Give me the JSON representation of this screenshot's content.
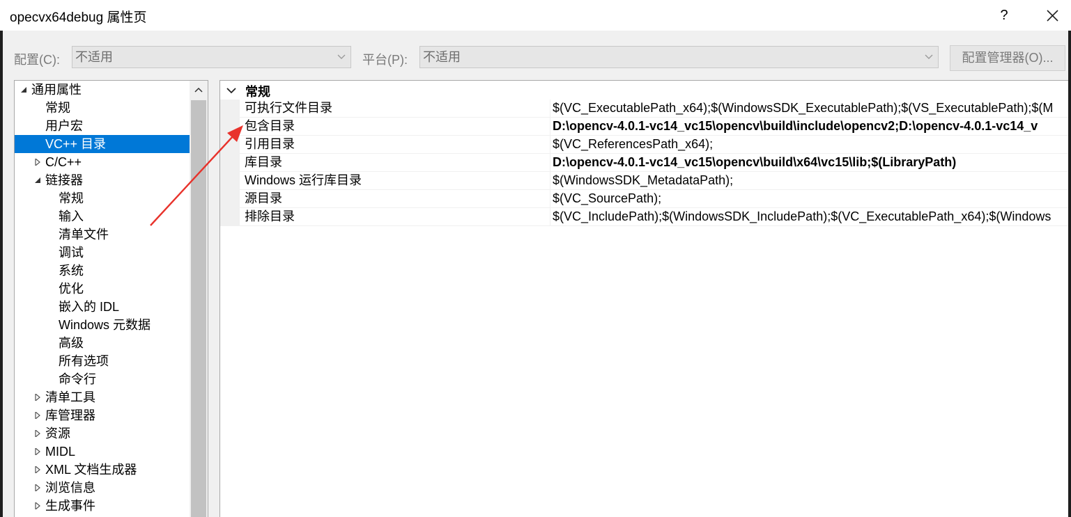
{
  "window": {
    "title": "opecvx64debug 属性页",
    "help_label": "?"
  },
  "toolbar": {
    "config_label": "配置(C):",
    "config_value": "不适用",
    "platform_label": "平台(P):",
    "platform_value": "不适用",
    "config_manager_label": "配置管理器(O)..."
  },
  "tree": {
    "items": [
      {
        "label": "通用属性",
        "expander": "expanded"
      },
      {
        "label": "常规"
      },
      {
        "label": "用户宏"
      },
      {
        "label": "VC++ 目录",
        "selected": true
      },
      {
        "label": "C/C++",
        "expander": "collapsed"
      },
      {
        "label": "链接器",
        "expander": "expanded"
      },
      {
        "label": "常规"
      },
      {
        "label": "输入"
      },
      {
        "label": "清单文件"
      },
      {
        "label": "调试"
      },
      {
        "label": "系统"
      },
      {
        "label": "优化"
      },
      {
        "label": "嵌入的 IDL"
      },
      {
        "label": "Windows 元数据"
      },
      {
        "label": "高级"
      },
      {
        "label": "所有选项"
      },
      {
        "label": "命令行"
      },
      {
        "label": "清单工具",
        "expander": "collapsed"
      },
      {
        "label": "库管理器",
        "expander": "collapsed"
      },
      {
        "label": "资源",
        "expander": "collapsed"
      },
      {
        "label": "MIDL",
        "expander": "collapsed"
      },
      {
        "label": "XML 文档生成器",
        "expander": "collapsed"
      },
      {
        "label": "浏览信息",
        "expander": "collapsed"
      },
      {
        "label": "生成事件",
        "expander": "collapsed"
      }
    ]
  },
  "grid": {
    "category": "常规",
    "rows": [
      {
        "name": "可执行文件目录",
        "value": "$(VC_ExecutablePath_x64);$(WindowsSDK_ExecutablePath);$(VS_ExecutablePath);$(M",
        "bold": false
      },
      {
        "name": "包含目录",
        "value": "D:\\opencv-4.0.1-vc14_vc15\\opencv\\build\\include\\opencv2;D:\\opencv-4.0.1-vc14_v",
        "bold": true
      },
      {
        "name": "引用目录",
        "value": "$(VC_ReferencesPath_x64);",
        "bold": false
      },
      {
        "name": "库目录",
        "value": "D:\\opencv-4.0.1-vc14_vc15\\opencv\\build\\x64\\vc15\\lib;$(LibraryPath)",
        "bold": true
      },
      {
        "name": "Windows 运行库目录",
        "value": "$(WindowsSDK_MetadataPath);",
        "bold": false
      },
      {
        "name": "源目录",
        "value": "$(VC_SourcePath);",
        "bold": false
      },
      {
        "name": "排除目录",
        "value": "$(VC_IncludePath);$(WindowsSDK_IncludePath);$(VC_ExecutablePath_x64);$(Windows",
        "bold": false
      }
    ]
  },
  "colors": {
    "selection": "#0078d7",
    "annotation_arrow": "#e8322b"
  }
}
